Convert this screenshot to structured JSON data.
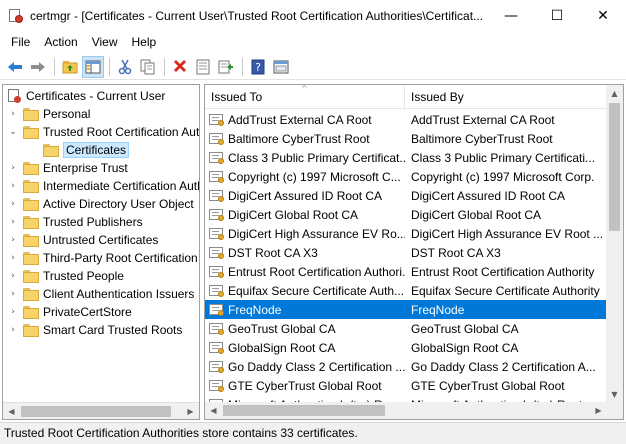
{
  "window": {
    "title": "certmgr - [Certificates - Current User\\Trusted Root Certification Authorities\\Certificat...",
    "minimize": "—",
    "maximize": "☐",
    "close": "✕"
  },
  "menu": [
    "File",
    "Action",
    "View",
    "Help"
  ],
  "toolbar": {
    "buttons": [
      "back-icon",
      "forward-icon",
      "up-folder-icon",
      "show-hide-tree-icon",
      "cut-icon",
      "copy-icon",
      "delete-icon",
      "properties-icon",
      "export-list-icon",
      "help-icon",
      "console-icon"
    ]
  },
  "tree": {
    "root": "Certificates - Current User",
    "items": [
      {
        "label": "Personal",
        "expander": "›"
      },
      {
        "label": "Trusted Root Certification Authorities",
        "expander": "⌄"
      },
      {
        "label": "Certificates",
        "selected": true
      },
      {
        "label": "Enterprise Trust",
        "expander": "›"
      },
      {
        "label": "Intermediate Certification Authorities",
        "expander": "›"
      },
      {
        "label": "Active Directory User Object",
        "expander": "›"
      },
      {
        "label": "Trusted Publishers",
        "expander": "›"
      },
      {
        "label": "Untrusted Certificates",
        "expander": "›"
      },
      {
        "label": "Third-Party Root Certification Authorities",
        "expander": "›"
      },
      {
        "label": "Trusted People",
        "expander": "›"
      },
      {
        "label": "Client Authentication Issuers",
        "expander": "›"
      },
      {
        "label": "PrivateCertStore",
        "expander": "›"
      },
      {
        "label": "Smart Card Trusted Roots",
        "expander": "›"
      }
    ]
  },
  "list": {
    "columns": [
      "Issued To",
      "Issued By"
    ],
    "sort_indicator": "^",
    "rows": [
      {
        "issued_to": "AddTrust External CA Root",
        "issued_by": "AddTrust External CA Root"
      },
      {
        "issued_to": "Baltimore CyberTrust Root",
        "issued_by": "Baltimore CyberTrust Root"
      },
      {
        "issued_to": "Class 3 Public Primary Certificat...",
        "issued_by": "Class 3 Public Primary Certificati..."
      },
      {
        "issued_to": "Copyright (c) 1997 Microsoft C...",
        "issued_by": "Copyright (c) 1997 Microsoft Corp."
      },
      {
        "issued_to": "DigiCert Assured ID Root CA",
        "issued_by": "DigiCert Assured ID Root CA"
      },
      {
        "issued_to": "DigiCert Global Root CA",
        "issued_by": "DigiCert Global Root CA"
      },
      {
        "issued_to": "DigiCert High Assurance EV Ro...",
        "issued_by": "DigiCert High Assurance EV Root ..."
      },
      {
        "issued_to": "DST Root CA X3",
        "issued_by": "DST Root CA X3"
      },
      {
        "issued_to": "Entrust Root Certification Authori...",
        "issued_by": "Entrust Root Certification Authority"
      },
      {
        "issued_to": "Equifax Secure Certificate Auth...",
        "issued_by": "Equifax Secure Certificate Authority"
      },
      {
        "issued_to": "FreqNode",
        "issued_by": "FreqNode",
        "selected": true
      },
      {
        "issued_to": "GeoTrust Global CA",
        "issued_by": "GeoTrust Global CA"
      },
      {
        "issued_to": "GlobalSign Root CA",
        "issued_by": "GlobalSign Root CA"
      },
      {
        "issued_to": "Go Daddy Class 2 Certification ...",
        "issued_by": "Go Daddy Class 2 Certification A..."
      },
      {
        "issued_to": "GTE CyberTrust Global Root",
        "issued_by": "GTE CyberTrust Global Root"
      },
      {
        "issued_to": "Microsoft Authenticode(tm) Ro...",
        "issued_by": "Microsoft Authenticode(tm) Root..."
      }
    ]
  },
  "status": "Trusted Root Certification Authorities store contains 33 certificates."
}
